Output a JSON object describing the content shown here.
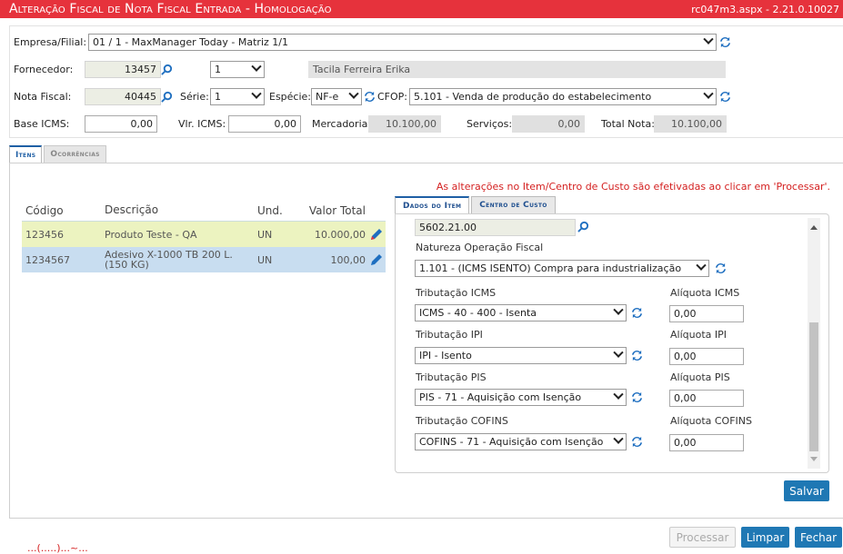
{
  "window": {
    "title": "Alteração Fiscal de Nota Fiscal Entrada  - Homologação",
    "version": "rc047m3.aspx - 2.21.0.10027"
  },
  "header": {
    "empresa_label": "Empresa/Filial:",
    "empresa_value": "01 / 1 - MaxManager Today - Matriz 1/1",
    "fornecedor_label": "Fornecedor:",
    "fornecedor_code": "13457",
    "fornecedor_select": "1",
    "fornecedor_name": "Tacila Ferreira Erika",
    "nota_label": "Nota Fiscal:",
    "nota_value": "40445",
    "serie_label": "Série:",
    "serie_value": "1",
    "especie_label": "Espécie:",
    "especie_value": "NF-e",
    "cfop_label": "CFOP:",
    "cfop_value": "5.101 - Venda de produção do estabelecimento",
    "base_icms_label": "Base ICMS:",
    "base_icms_value": "0,00",
    "vlr_icms_label": "Vlr. ICMS:",
    "vlr_icms_value": "0,00",
    "mercadoria_label": "Mercadoria:",
    "mercadoria_value": "10.100,00",
    "servicos_label": "Serviços:",
    "servicos_value": "0,00",
    "total_label": "Total Nota:",
    "total_value": "10.100,00"
  },
  "tabs": {
    "itens": "Itens",
    "ocorrencias": "Ocorrências"
  },
  "notice": "As alterações no Item/Centro de Custo são efetivadas ao clicar em 'Processar'.",
  "grid": {
    "headers": [
      "Código",
      "Descrição",
      "Und.",
      "Valor Total"
    ],
    "rows": [
      {
        "codigo": "123456",
        "descricao": "Produto Teste - QA",
        "und": "UN",
        "valor": "10.000,00"
      },
      {
        "codigo": "1234567",
        "descricao": "Adesivo X-1000 TB 200 L. (150 KG)",
        "und": "UN",
        "valor": "100,00"
      }
    ]
  },
  "subtabs": {
    "dados": "Dados do Item",
    "centro": "Centro de Custo"
  },
  "detail": {
    "ncm_value": "5602.21.00",
    "natureza_label": "Natureza Operação Fiscal",
    "natureza_value": "1.101 - (ICMS ISENTO) Compra para industrialização",
    "icms_label": "Tributação ICMS",
    "icms_value": "ICMS - 40 - 400 - Isenta",
    "aliq_icms_label": "Alíquota ICMS",
    "aliq_icms_value": "0,00",
    "ipi_label": "Tributação IPI",
    "ipi_value": "IPI - Isento",
    "aliq_ipi_label": "Alíquota IPI",
    "aliq_ipi_value": "0,00",
    "pis_label": "Tributação PIS",
    "pis_value": "PIS - 71 - Aquisição com Isenção",
    "aliq_pis_label": "Alíquota PIS",
    "aliq_pis_value": "0,00",
    "cofins_label": "Tributação COFINS",
    "cofins_value": "COFINS - 71 - Aquisição com Isenção",
    "aliq_cofins_label": "Alíquota COFINS",
    "aliq_cofins_value": "0,00"
  },
  "buttons": {
    "salvar": "Salvar",
    "processar": "Processar",
    "limpar": "Limpar",
    "fechar": "Fechar"
  },
  "footer_text": "...(.....)...~..."
}
